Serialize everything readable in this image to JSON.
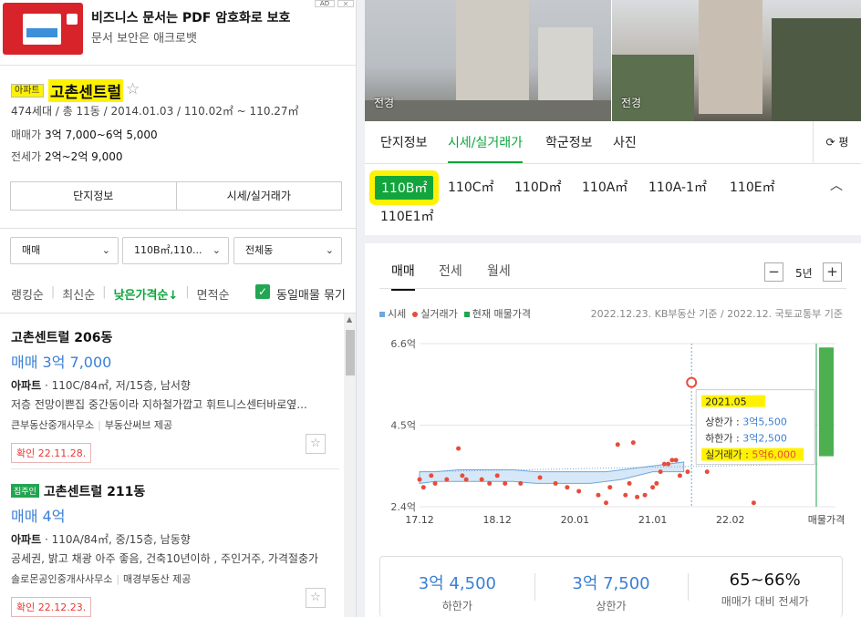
{
  "ad": {
    "title": "비즈니스 문서는 PDF 암호화로 보호",
    "subtitle": "문서 보안은 애크로뱃",
    "badge": "AD",
    "close": "✕"
  },
  "complex": {
    "type": "아파트",
    "name": "고촌센트럴",
    "star": "☆",
    "info": "474세대 / 총 11동 / 2014.01.03 / 110.02㎡ ~ 110.27㎡",
    "sale_label": "매매가",
    "sale_value": "3억 7,000~6억 5,000",
    "lease_label": "전세가",
    "lease_value": "2억~2억 9,000"
  },
  "left_buttons": [
    "단지정보",
    "시세/실거래가"
  ],
  "filters": {
    "trade": "매매",
    "area": "110B㎡,110...",
    "dong": "전체동",
    "chev": "⌄"
  },
  "sorts": [
    "랭킹순",
    "최신순",
    "낮은가격순↓",
    "면적순"
  ],
  "same_listing": {
    "check": "✓",
    "label": "동일매물 묶기"
  },
  "listings": [
    {
      "title": "고촌센트럴 206동",
      "badge": "",
      "price": "매매 3억 7,000",
      "type": "아파트",
      "spec": "· 110C/84㎡, 저/15층, 남서향",
      "desc": "저층 전망이쁜집 중간동이라 지하철가깝고 휘트니스센터바로옆...",
      "agent": "큰부동산중개사무소",
      "provider": "부동산써브 제공",
      "confirm": "확인 22.11.28."
    },
    {
      "title": "고촌센트럴 211동",
      "badge": "집주인",
      "price": "매매 4억",
      "type": "아파트",
      "spec": "· 110A/84㎡, 중/15층, 남동향",
      "desc": "공세권, 밝고 채광 아주 좋음, 건축10년이하 , 주인거주, 가격절충가",
      "agent": "솔로몬공인중개사사무소",
      "provider": "매경부동산 제공",
      "confirm": "확인 22.12.23."
    }
  ],
  "photos": [
    {
      "label": "전경"
    },
    {
      "label": "전경"
    }
  ],
  "tabs": [
    "단지정보",
    "시세/실거래가",
    "학군정보",
    "사진"
  ],
  "refresh": "⟳ 평",
  "sizes": [
    "110B㎡",
    "110C㎡",
    "110D㎡",
    "110A㎡",
    "110A-1㎡",
    "110E㎡",
    "110E1㎡"
  ],
  "sizes_toggle": "︿",
  "sub_tabs": [
    "매매",
    "전세",
    "월세"
  ],
  "period": {
    "minus": "−",
    "value": "5년",
    "plus": "+"
  },
  "legend": [
    {
      "label": "시세",
      "color": "#6fa8dc"
    },
    {
      "label": "실거래가",
      "color": "#e74c3c"
    },
    {
      "label": "현재 매물가격",
      "color": "#21a651"
    }
  ],
  "source": "2022.12.23. KB부동산 기준 / 2022.12. 국토교통부 기준",
  "chart_data": {
    "type": "line",
    "y_ticks": [
      "6.6억",
      "4.5억",
      "2.4억"
    ],
    "ylim": [
      2.4,
      6.6
    ],
    "x_ticks": [
      "17.12",
      "18.12",
      "20.01",
      "21.01",
      "22.02",
      "매물가격"
    ],
    "series": [
      {
        "name": "시세",
        "color": "#6fa8dc"
      },
      {
        "name": "실거래가",
        "color": "#e74c3c"
      },
      {
        "name": "현재 매물가격",
        "color": "#21a651"
      }
    ],
    "kb_upper": [
      [
        0.0,
        3.3
      ],
      [
        0.1,
        3.3
      ],
      [
        0.2,
        3.3
      ],
      [
        0.5,
        3.35
      ],
      [
        0.9,
        3.35
      ],
      [
        1.2,
        3.35
      ],
      [
        1.5,
        3.3
      ],
      [
        1.9,
        3.3
      ],
      [
        2.2,
        3.3
      ],
      [
        2.4,
        3.3
      ],
      [
        2.6,
        3.35
      ],
      [
        2.8,
        3.4
      ],
      [
        3.0,
        3.45
      ],
      [
        3.2,
        3.5
      ],
      [
        3.4,
        3.55
      ]
    ],
    "kb_lower": [
      [
        0.0,
        3.0
      ],
      [
        0.2,
        3.05
      ],
      [
        0.5,
        3.05
      ],
      [
        0.9,
        3.05
      ],
      [
        1.2,
        3.05
      ],
      [
        1.5,
        3.0
      ],
      [
        1.9,
        3.0
      ],
      [
        2.2,
        3.0
      ],
      [
        2.4,
        3.05
      ],
      [
        2.6,
        3.1
      ],
      [
        2.8,
        3.2
      ],
      [
        3.0,
        3.3
      ],
      [
        3.2,
        3.3
      ],
      [
        3.4,
        3.3
      ]
    ],
    "deals": [
      [
        0.0,
        3.1
      ],
      [
        0.05,
        2.9
      ],
      [
        0.15,
        3.2
      ],
      [
        0.2,
        3.0
      ],
      [
        0.35,
        3.1
      ],
      [
        0.5,
        3.9
      ],
      [
        0.55,
        3.2
      ],
      [
        0.6,
        3.1
      ],
      [
        0.8,
        3.1
      ],
      [
        0.9,
        3.0
      ],
      [
        1.0,
        3.2
      ],
      [
        1.1,
        3.0
      ],
      [
        1.3,
        3.0
      ],
      [
        1.55,
        3.15
      ],
      [
        1.75,
        3.0
      ],
      [
        1.9,
        2.9
      ],
      [
        2.05,
        2.8
      ],
      [
        2.3,
        2.7
      ],
      [
        2.4,
        2.5
      ],
      [
        2.45,
        2.9
      ],
      [
        2.55,
        4.0
      ],
      [
        2.65,
        2.7
      ],
      [
        2.7,
        3.0
      ],
      [
        2.75,
        4.05
      ],
      [
        2.8,
        2.65
      ],
      [
        2.9,
        2.7
      ],
      [
        3.0,
        2.9
      ],
      [
        3.05,
        3.0
      ],
      [
        3.1,
        3.3
      ],
      [
        3.15,
        3.5
      ],
      [
        3.2,
        3.5
      ],
      [
        3.25,
        3.6
      ],
      [
        3.3,
        3.6
      ],
      [
        3.35,
        3.2
      ],
      [
        3.45,
        3.3
      ],
      [
        3.5,
        5.6
      ],
      [
        3.6,
        3.8
      ],
      [
        3.7,
        3.3
      ],
      [
        3.8,
        3.9
      ],
      [
        3.85,
        3.7
      ],
      [
        4.3,
        2.5
      ]
    ],
    "listing_range": [
      3.7,
      6.5
    ],
    "tooltip": {
      "date": "2021.05",
      "upper_label": "상한가 : ",
      "upper_value": "3억5,500",
      "lower_label": "하한가 : ",
      "lower_value": "3억2,500",
      "deal_label": "실거래가 : ",
      "deal_value": "5억6,000"
    }
  },
  "summary": [
    {
      "value": "3억 4,500",
      "label": "하한가"
    },
    {
      "value": "3억 7,500",
      "label": "상한가"
    },
    {
      "value": "65~66%",
      "label": "매매가 대비 전세가"
    }
  ]
}
